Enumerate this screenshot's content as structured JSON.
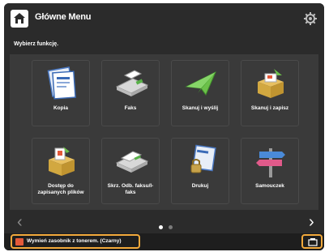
{
  "header": {
    "title": "Główne Menu",
    "home_icon": "home-icon",
    "settings_icon": "gear-icon"
  },
  "instruction": "Wybierz funkcję.",
  "tiles": [
    {
      "label": "Kopia",
      "icon": "copy-icon"
    },
    {
      "label": "Faks",
      "icon": "fax-icon"
    },
    {
      "label": "Skanuj i wyślij",
      "icon": "scan-send-icon"
    },
    {
      "label": "Skanuj i zapisz",
      "icon": "scan-store-icon"
    },
    {
      "label": "Dostęp do zapisanych plików",
      "icon": "stored-files-icon"
    },
    {
      "label": "Skrz. Odb. faksu/I-faks",
      "icon": "fax-inbox-icon"
    },
    {
      "label": "Drukuj",
      "icon": "print-icon"
    },
    {
      "label": "Samouczek",
      "icon": "tutorial-icon"
    }
  ],
  "pagination": {
    "current": 1,
    "total": 2
  },
  "status_bar": {
    "message": "Wymień zasobnik z tonerem. (Czarny)",
    "message_icon": "warning-badge-icon",
    "monitor_icon": "status-monitor-icon"
  },
  "colors": {
    "highlight": "#f2a93b",
    "background": "#2b2b2b",
    "panel": "#3a3a3a"
  }
}
